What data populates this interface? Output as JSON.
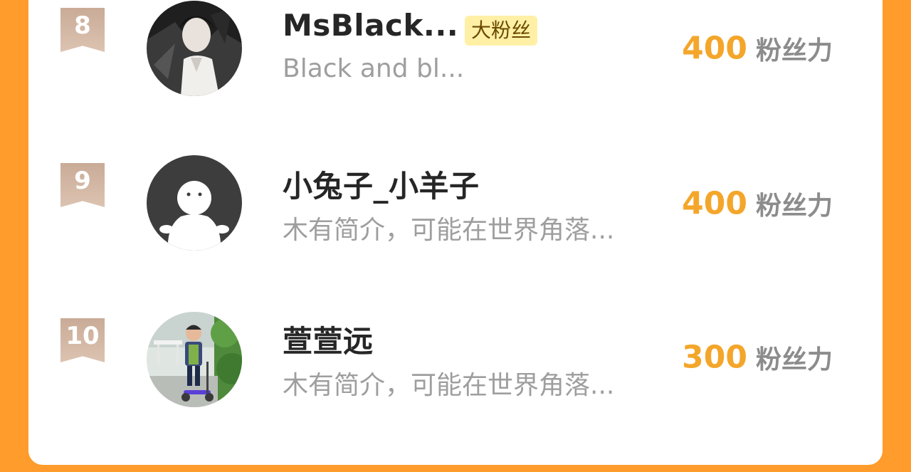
{
  "colors": {
    "background": "#FF9C2B",
    "card": "#FFFFFF",
    "score": "#F4A62A",
    "fan_tag_bg": "#FFF0A6",
    "rank_badge": "#D4B8A4"
  },
  "ranking": {
    "items": [
      {
        "rank": "8",
        "name": "MsBlack...",
        "tag": "大粉丝",
        "description": "Black and bl...",
        "score": "400",
        "score_unit": "粉丝力",
        "avatar_icon": "anime-boy-photo-avatar"
      },
      {
        "rank": "9",
        "name": "小兔子_小羊子",
        "tag": "",
        "description": "木有简介，可能在世界角落...",
        "score": "400",
        "score_unit": "粉丝力",
        "avatar_icon": "default-user-avatar"
      },
      {
        "rank": "10",
        "name": "萱萱远",
        "tag": "",
        "description": "木有简介，可能在世界角落...",
        "score": "300",
        "score_unit": "粉丝力",
        "avatar_icon": "child-scooter-photo-avatar"
      }
    ]
  }
}
